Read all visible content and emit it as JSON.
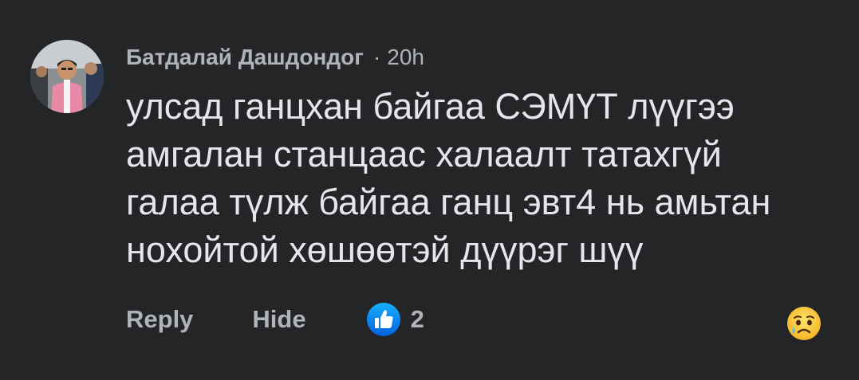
{
  "comment": {
    "author": "Батдалай Дашдондог",
    "separator": "·",
    "time": "20h",
    "lines": [
      "улсад ганцхан байгаа СЭМҮТ лүүгээ",
      "амгалан станцаас халаалт татахгүй",
      "галаа түлж байгаа ганц эвт4 нь амьтан",
      "нохойтой хөшөөтэй дүүрэг шүү"
    ]
  },
  "actions": {
    "reply_label": "Reply",
    "hide_label": "Hide",
    "like_count": "2"
  },
  "icons": {
    "like": "thumbs-up-icon",
    "reaction_picker": "sad-face-emoji-icon"
  },
  "colors": {
    "background": "#242526",
    "primary_text": "#e4e6eb",
    "secondary_text": "#b0b3b8",
    "like_blue": "#1877f2"
  }
}
